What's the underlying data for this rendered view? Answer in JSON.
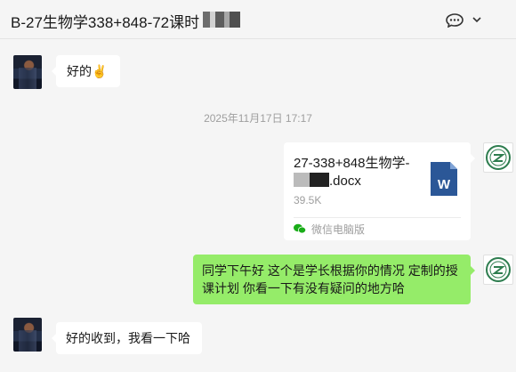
{
  "header": {
    "title": "B-27生物学338+848-72课时"
  },
  "messages": [
    {
      "sender": "contact",
      "text": "好的✌️"
    },
    {
      "type": "timestamp",
      "text": "2025年11月17日 17:17"
    },
    {
      "sender": "me",
      "type": "file",
      "file_name_line1": "27-338+848生物学-",
      "file_name_line2": ".docx",
      "file_size": "39.5K",
      "source_label": "微信电脑版",
      "file_icon_letter": "W"
    },
    {
      "sender": "me",
      "text": "同学下午好 这个是学长根据你的情况 定制的授课计划 你看一下有没有疑问的地方哈"
    },
    {
      "sender": "contact",
      "text": "好的收到，我看一下哈"
    }
  ],
  "icons": {
    "more": "more-icon",
    "chevron": "chevron-down-icon",
    "file": "word-file-icon",
    "source": "wechat-logo-icon"
  },
  "colors": {
    "background": "#f5f5f5",
    "my_bubble": "#95ec69",
    "their_bubble": "#ffffff",
    "word_blue": "#2b5797",
    "timestamp_gray": "#9e9e9e"
  }
}
